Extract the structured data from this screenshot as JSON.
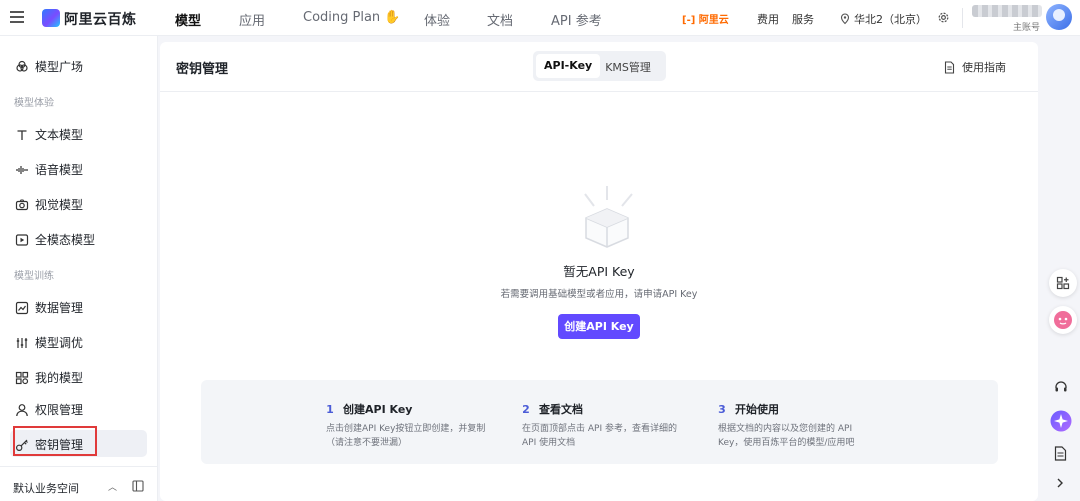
{
  "topbar": {
    "brand": "阿里云百炼",
    "nav": [
      "模型",
      "应用",
      "Coding Plan ✋",
      "体验",
      "文档",
      "API 参考"
    ],
    "aliyun_logo_text": "[-] 阿里云",
    "links": [
      "费用",
      "服务"
    ],
    "region": "华北2（北京）",
    "account_label": "主账号",
    "icons": [
      "menu-icon",
      "location-icon",
      "gear-icon"
    ]
  },
  "sidebar": {
    "items": [
      {
        "label": "模型广场",
        "icon": "cloud-icon"
      },
      {
        "group": "模型体验"
      },
      {
        "label": "文本模型",
        "icon": "text-icon"
      },
      {
        "label": "语音模型",
        "icon": "waveform-icon"
      },
      {
        "label": "视觉模型",
        "icon": "camera-icon"
      },
      {
        "label": "全模态模型",
        "icon": "play-box-icon"
      },
      {
        "group": "模型训练"
      },
      {
        "label": "数据管理",
        "icon": "chart-icon"
      },
      {
        "label": "模型调优",
        "icon": "sliders-icon"
      },
      {
        "label": "我的模型",
        "icon": "grid-icon"
      },
      {
        "label": "权限管理",
        "icon": "user-icon"
      },
      {
        "label": "密钥管理",
        "icon": "key-icon",
        "active": true
      }
    ],
    "group_labels": {
      "experience": "模型体验",
      "training": "模型训练"
    },
    "footer": {
      "workspace": "默认业务空间"
    }
  },
  "main": {
    "title": "密钥管理",
    "tabs": [
      {
        "label": "API-Key",
        "active": true
      },
      {
        "label": "KMS管理",
        "active": false
      }
    ],
    "guide": "使用指南",
    "empty": {
      "title": "暂无API Key",
      "description": "若需要调用基础模型或者应用，请申请API Key",
      "button": "创建API Key"
    },
    "steps": [
      {
        "num": "1",
        "title": "创建API Key",
        "desc": "点击创建API Key按钮立即创建，并复制（请注意不要泄漏）"
      },
      {
        "num": "2",
        "title": "查看文档",
        "desc": "在页面顶部点击 API 参考，查看详细的 API 使用文档"
      },
      {
        "num": "3",
        "title": "开始使用",
        "desc": "根据文档的内容以及您创建的 API Key，使用百炼平台的模型/应用吧"
      }
    ]
  },
  "colors": {
    "accent": "#624aff",
    "highlight_box": "#e03a3a",
    "aliyun_orange": "#ff6a00"
  }
}
